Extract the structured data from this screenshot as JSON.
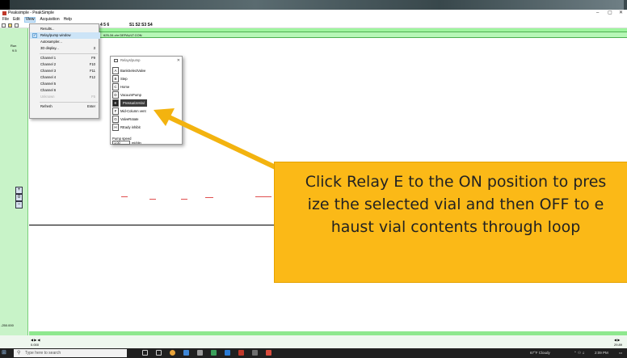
{
  "window": {
    "title": "Peaksimple - PeakSimple",
    "min_label": "–",
    "max_label": "▢",
    "close_label": "✕"
  },
  "menubar": [
    {
      "label": "File"
    },
    {
      "label": "Edit"
    },
    {
      "label": "View"
    },
    {
      "label": "Acquisition"
    },
    {
      "label": "Help"
    }
  ],
  "toolbar": {
    "channels": "4 5 6",
    "sets": "S1 S2 S3 S4"
  },
  "panel": {
    "left_label_1": "Run",
    "left_label_2": "9.5",
    "path": "625-34.chr DEFAULT.CON",
    "ymin": "-250.000",
    "xmin": "0.000",
    "xmax": "29.89"
  },
  "view_menu": {
    "items": [
      {
        "label": "Results...",
        "shortcut": ""
      },
      {
        "label": "Relay/pump window",
        "shortcut": "",
        "checked": true
      },
      {
        "label": "Autosampler...",
        "shortcut": ""
      },
      {
        "label": "3D display...",
        "shortcut": "3"
      },
      {
        "label": "Channel 1",
        "shortcut": "F9"
      },
      {
        "label": "Channel 2",
        "shortcut": "F10"
      },
      {
        "label": "Channel 3",
        "shortcut": "F11"
      },
      {
        "label": "Channel 4",
        "shortcut": "F12"
      },
      {
        "label": "Channel 5",
        "shortcut": ""
      },
      {
        "label": "Channel 6",
        "shortcut": ""
      },
      {
        "label": "Unknown",
        "shortcut": "F5"
      },
      {
        "label": "Refresh",
        "shortcut": "Enter"
      }
    ],
    "check_mark": "✓"
  },
  "relay_window": {
    "title": "Relays/pump",
    "close": "✕",
    "relays": [
      {
        "key": "A",
        "label": "BankSelectValve",
        "on": false
      },
      {
        "key": "B",
        "label": "Step",
        "on": false
      },
      {
        "key": "C",
        "label": "Home",
        "on": false
      },
      {
        "key": "D",
        "label": "VacuumPump",
        "on": false
      },
      {
        "key": "E",
        "label": "PressurizeVial",
        "on": true
      },
      {
        "key": "F",
        "label": "Mid-Column vent",
        "on": false
      },
      {
        "key": "G",
        "label": "ValveRotate",
        "on": false
      },
      {
        "key": "H",
        "label": "REady inhibit",
        "on": false
      }
    ],
    "pump_speed_label": "Pump speed",
    "pump_speed_value": "1.00",
    "pump_speed_unit": "ml/Min"
  },
  "callout": {
    "text": "Click Relay E to the ON position to pressurize the selected vial and then OFF to exhaust vial contents through loop",
    "line1": "Click Relay E to the ON position to pres",
    "line2": "ize the selected vial and then OFF to e",
    "line3": "haust vial contents through loop",
    "color": "#fbb917",
    "arrow_color": "#f3b30f"
  },
  "taskbar": {
    "search_placeholder": "Type here to search",
    "weather": "67°F Cloudy",
    "time": "2:09 PM"
  },
  "colors": {
    "green_panel": "#c8f3c8",
    "header_green": "#9ef59e",
    "trace_red": "#e05050"
  }
}
